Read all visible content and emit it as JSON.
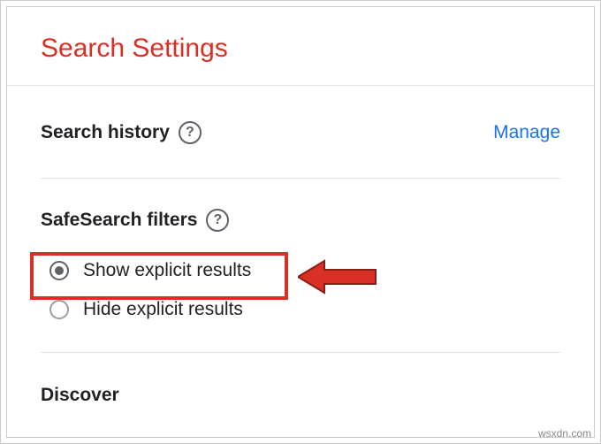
{
  "header": {
    "title": "Search Settings"
  },
  "history": {
    "label": "Search history",
    "help_icon": "?",
    "manage": "Manage"
  },
  "safesearch": {
    "label": "SafeSearch filters",
    "help_icon": "?",
    "options": {
      "show": "Show explicit results",
      "hide": "Hide explicit results"
    }
  },
  "discover": {
    "label": "Discover"
  },
  "watermark": "wsxdn.com"
}
